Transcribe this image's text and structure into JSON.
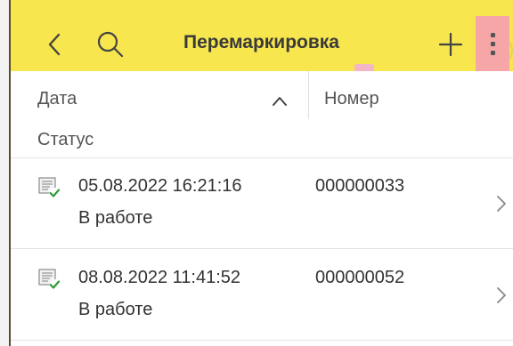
{
  "header": {
    "title": "Перемаркировка",
    "back_icon": "chevron-left-icon",
    "search_icon": "search-icon",
    "add_icon": "plus-icon",
    "menu_icon": "more-vertical-icon",
    "background_color": "#f7e64e"
  },
  "columns": {
    "date": "Дата",
    "number": "Номер",
    "status": "Статус",
    "sort_icon": "chevron-up-icon"
  },
  "rows": [
    {
      "date": "05.08.2022 16:21:16",
      "number": "000000033",
      "status": "В работе",
      "icon": "document-check-icon"
    },
    {
      "date": "08.08.2022 11:41:52",
      "number": "000000052",
      "status": "В работе",
      "icon": "document-check-icon"
    }
  ]
}
